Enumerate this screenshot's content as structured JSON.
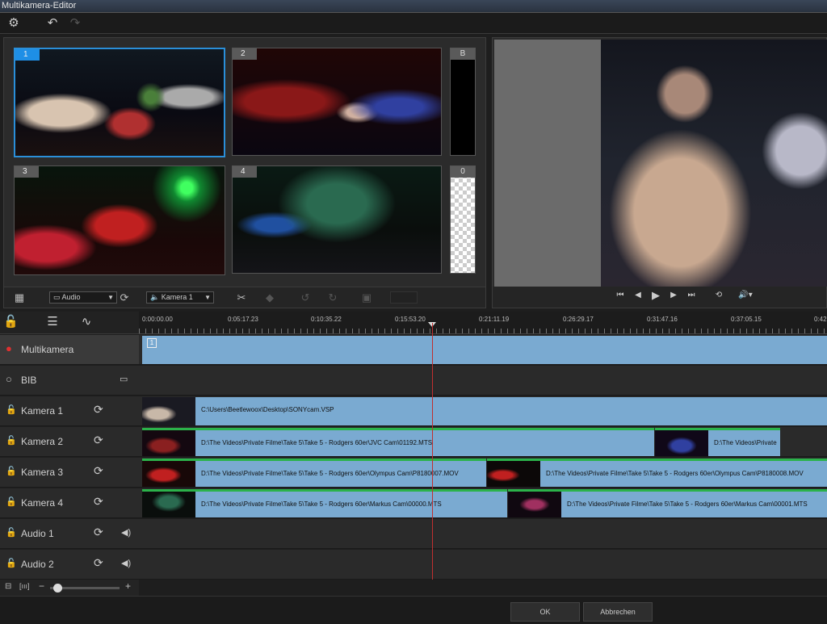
{
  "window": {
    "title": "Multikamera-Editor"
  },
  "toolbar": {
    "settings_icon": "gear-icon",
    "undo_icon": "undo-icon",
    "redo_icon": "redo-icon"
  },
  "sources": {
    "cameras": [
      {
        "number": "1",
        "selected": true
      },
      {
        "number": "2",
        "selected": false
      },
      {
        "number": "3",
        "selected": false
      },
      {
        "number": "4",
        "selected": false
      }
    ],
    "side": [
      {
        "label": "B"
      },
      {
        "label": "0"
      }
    ],
    "bar": {
      "audio_dropdown": "Audio",
      "camera_dropdown": "Kamera 1"
    }
  },
  "timeline": {
    "timecodes": [
      "0:00:00.00",
      "0:05:17.23",
      "0:10:35.22",
      "0:15:53.20",
      "0:21:11.19",
      "0:26:29.17",
      "0:31:47.16",
      "0:37:05.15",
      "0:42"
    ],
    "tracks": [
      {
        "name": "Multikamera",
        "type": "record"
      },
      {
        "name": "BIB",
        "type": "pip"
      },
      {
        "name": "Kamera 1",
        "type": "camera"
      },
      {
        "name": "Kamera 2",
        "type": "camera"
      },
      {
        "name": "Kamera 3",
        "type": "camera"
      },
      {
        "name": "Kamera 4",
        "type": "camera"
      },
      {
        "name": "Audio 1",
        "type": "audio"
      },
      {
        "name": "Audio 2",
        "type": "audio"
      }
    ],
    "multicam_clip_label": "1",
    "clips": {
      "k1": [
        "C:\\Users\\Beetlewoox\\Desktop\\SONYcam.VSP"
      ],
      "k2": [
        "D:\\The Videos\\Private Filme\\Take 5\\Take 5 - Rodgers 60er\\JVC Cam\\01192.MTS",
        "D:\\The Videos\\Private"
      ],
      "k3": [
        "D:\\The Videos\\Private Filme\\Take 5\\Take 5 - Rodgers 60er\\Olympus Cam\\P8180007.MOV",
        "D:\\The Videos\\Private Filme\\Take 5\\Take 5 - Rodgers 60er\\Olympus Cam\\P8180008.MOV"
      ],
      "k4": [
        "D:\\The Videos\\Private Filme\\Take 5\\Take 5 - Rodgers 60er\\Markus Cam\\00000.MTS",
        "D:\\The Videos\\Private Filme\\Take 5\\Take 5 - Rodgers 60er\\Markus Cam\\00001.MTS"
      ]
    }
  },
  "footer": {
    "ok_label": "OK",
    "cancel_label": "Abbrechen"
  }
}
